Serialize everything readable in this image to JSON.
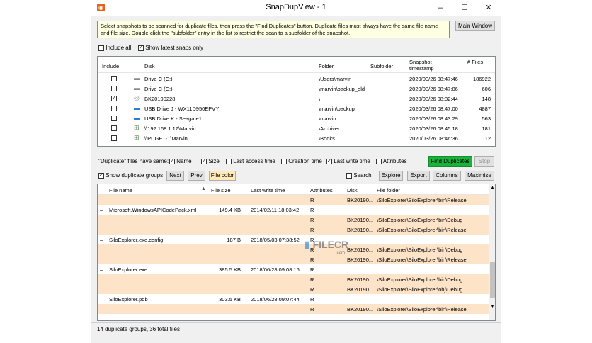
{
  "window": {
    "title": "SnapDupView - 1",
    "min": "–",
    "max": "☐",
    "close": "✕"
  },
  "info_text": "Select snapshots to be scanned for duplicate files, then press the \"Find Duplicates\" button.  Duplicate files must always have the same file name and file size.  Double-click the \"subfolder\" entry in the list to restrict the scan to a subfolder of the snapshot.",
  "main_window_button": "Main Window",
  "snap_options": {
    "include_all": "Include all",
    "show_latest": "Show latest snaps only"
  },
  "snap_table": {
    "headers": {
      "include": "Include",
      "disk": "Disk",
      "folder": "Folder",
      "subfolder": "Subfolder",
      "timestamp": "Snapshot timestamp",
      "files": "# Files"
    },
    "rows": [
      {
        "checked": false,
        "icon": "drive-icon",
        "disk": "Drive C (C:)",
        "folder": "\\Users\\marvin",
        "timestamp": "2020/03/26 08:47:46",
        "files": "186922"
      },
      {
        "checked": false,
        "icon": "drive-icon",
        "disk": "Drive C (C:)",
        "folder": "\\marvin\\backup_old",
        "timestamp": "2020/03/26 08:47:06",
        "files": "606"
      },
      {
        "checked": true,
        "icon": "disc-icon",
        "disk": "BK20190228",
        "folder": "\\",
        "timestamp": "2020/03/26 08:32:44",
        "files": "148"
      },
      {
        "checked": false,
        "icon": "usb-drive-icon",
        "disk": "USB Drive J - WX11D950EPVY",
        "folder": "\\marvin\\backup",
        "timestamp": "2020/03/26 08:47:00",
        "files": "4887"
      },
      {
        "checked": false,
        "icon": "usb-drive-icon",
        "disk": "USB Drive K - Seagate1",
        "folder": "\\marvin",
        "timestamp": "2020/03/26 08:43:29",
        "files": "563"
      },
      {
        "checked": false,
        "icon": "network-icon",
        "disk": "\\\\192.168.1.17\\Marvin",
        "folder": "\\Archiver",
        "timestamp": "2020/03/26 08:45:18",
        "files": "181"
      },
      {
        "checked": false,
        "icon": "network-icon",
        "disk": "\\\\PUGET-1\\Marvin",
        "folder": "\\Books",
        "timestamp": "2020/03/26 08:46:36",
        "files": "12"
      }
    ]
  },
  "duplicate_opts": {
    "label": "\"Duplicate\" files have same:",
    "name": "Name",
    "size": "Size",
    "last_access": "Last access time",
    "creation": "Creation time",
    "last_write": "Last write time",
    "attributes": "Attributes",
    "find": "Find Duplicates",
    "stop": "Stop"
  },
  "toolbar2": {
    "show_groups": "Show duplicate groups",
    "next": "Next",
    "prev": "Prev",
    "file_color": "File color",
    "search": "Search",
    "explore": "Explore",
    "export": "Export",
    "columns": "Columns",
    "maximize": "Maximize"
  },
  "dup_table": {
    "headers": {
      "file_name": "File name",
      "file_size": "File size",
      "last_write": "Last write time",
      "attributes": "Attributes",
      "disk": "Disk",
      "file_folder": "File folder"
    },
    "rows": [
      {
        "kind": "file",
        "attr": "R",
        "disk": "BK20190...",
        "folder": "\\SiloExplorer\\SiloExplorer\\bin\\Release"
      },
      {
        "kind": "group",
        "name": "Microsoft.WindowsAPICodePack.xml",
        "size": "149.4 KB",
        "time": "2014/02/11 18:03:42",
        "attr": "R"
      },
      {
        "kind": "file",
        "attr": "R",
        "disk": "BK20190...",
        "folder": "\\SiloExplorer\\SiloExplorer\\bin\\Debug"
      },
      {
        "kind": "file",
        "attr": "R",
        "disk": "BK20190...",
        "folder": "\\SiloExplorer\\SiloExplorer\\bin\\Release"
      },
      {
        "kind": "group",
        "name": "SiloExplorer.exe.config",
        "size": "187 B",
        "time": "2018/05/03 07:38:52",
        "attr": "R"
      },
      {
        "kind": "file",
        "attr": "R",
        "disk": "BK20190...",
        "folder": "\\SiloExplorer\\SiloExplorer\\bin\\Debug"
      },
      {
        "kind": "file",
        "attr": "R",
        "disk": "BK20190...",
        "folder": "\\SiloExplorer\\SiloExplorer\\bin\\Release"
      },
      {
        "kind": "group",
        "name": "SiloExplorer.exe",
        "size": "385.5 KB",
        "time": "2018/06/28 09:08:16",
        "attr": "R"
      },
      {
        "kind": "file",
        "attr": "R",
        "disk": "BK20190...",
        "folder": "\\SiloExplorer\\SiloExplorer\\bin\\Debug"
      },
      {
        "kind": "file",
        "attr": "R",
        "disk": "BK20190...",
        "folder": "\\SiloExplorer\\SiloExplorer\\obj\\Debug"
      },
      {
        "kind": "group",
        "name": "SiloExplorer.pdb",
        "size": "303.5 KB",
        "time": "2018/06/28 09:07:44",
        "attr": "R"
      },
      {
        "kind": "file",
        "attr": "R",
        "disk": "BK20190...",
        "folder": "\\SiloExplorer\\SiloExplorer\\bin\\Release"
      }
    ]
  },
  "watermark": "FILECR",
  "watermark_sub": ".com",
  "status": "14 duplicate groups, 36 total files",
  "colors": {
    "file_row": "#fde3c8",
    "find_button": "#19b23b",
    "info_bg": "#ffffe1"
  }
}
